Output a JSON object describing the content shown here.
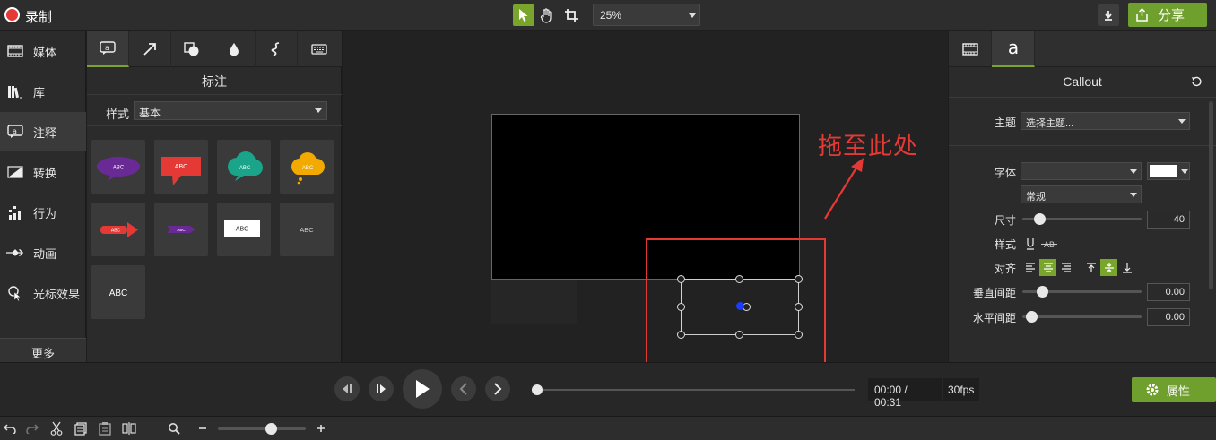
{
  "topbar": {
    "record_label": "录制",
    "zoom_value": "25%",
    "share_label": "分享"
  },
  "leftnav": {
    "items": [
      {
        "label": "媒体",
        "icon": "film-strip-icon"
      },
      {
        "label": "库",
        "icon": "library-icon"
      },
      {
        "label": "注释",
        "icon": "annotation-icon",
        "active": true
      },
      {
        "label": "转换",
        "icon": "transition-icon"
      },
      {
        "label": "行为",
        "icon": "behavior-icon"
      },
      {
        "label": "动画",
        "icon": "animation-icon"
      },
      {
        "label": "光标效果",
        "icon": "cursor-effect-icon"
      }
    ],
    "more_label": "更多"
  },
  "annotations": {
    "title": "标注",
    "style_label": "样式",
    "style_value": "基本",
    "tiles": [
      {
        "kind": "speech-bubble",
        "text": "ABC",
        "color": "#6a2a96"
      },
      {
        "kind": "callout-box",
        "text": "ABC",
        "color": "#e53935"
      },
      {
        "kind": "cloud",
        "text": "ABC",
        "color": "#1aa58a"
      },
      {
        "kind": "thought-cloud",
        "text": "ABC",
        "color": "#f2a900"
      },
      {
        "kind": "arrow",
        "text": "ABC",
        "color": "#e53935"
      },
      {
        "kind": "arrow-small",
        "text": "ABC",
        "color": "#6a2a96"
      },
      {
        "kind": "text-box",
        "text": "ABC",
        "color": "#ffffff"
      },
      {
        "kind": "plain-text",
        "text": "ABC",
        "color": "#cccccc"
      },
      {
        "kind": "plain-text-large",
        "text": "ABC",
        "color": "#ffffff"
      }
    ]
  },
  "canvas": {
    "drag_label": "拖至此处"
  },
  "properties": {
    "title": "Callout",
    "theme_label": "主题",
    "theme_value": "选择主题...",
    "font_label": "字体",
    "font_value": "",
    "font_style_value": "常规",
    "size_label": "尺寸",
    "size_value": "40",
    "text_style_label": "样式",
    "align_label": "对齐",
    "vspacing_label": "垂直间距",
    "vspacing_value": "0.00",
    "hspacing_label": "水平间距",
    "hspacing_value": "0.00"
  },
  "transport": {
    "time": "00:00 / 00:31",
    "fps": "30fps",
    "properties_label": "属性",
    "progress": 0
  },
  "colors": {
    "accent": "#7aa52c",
    "record": "#e53935",
    "highlight": "#e53935"
  }
}
